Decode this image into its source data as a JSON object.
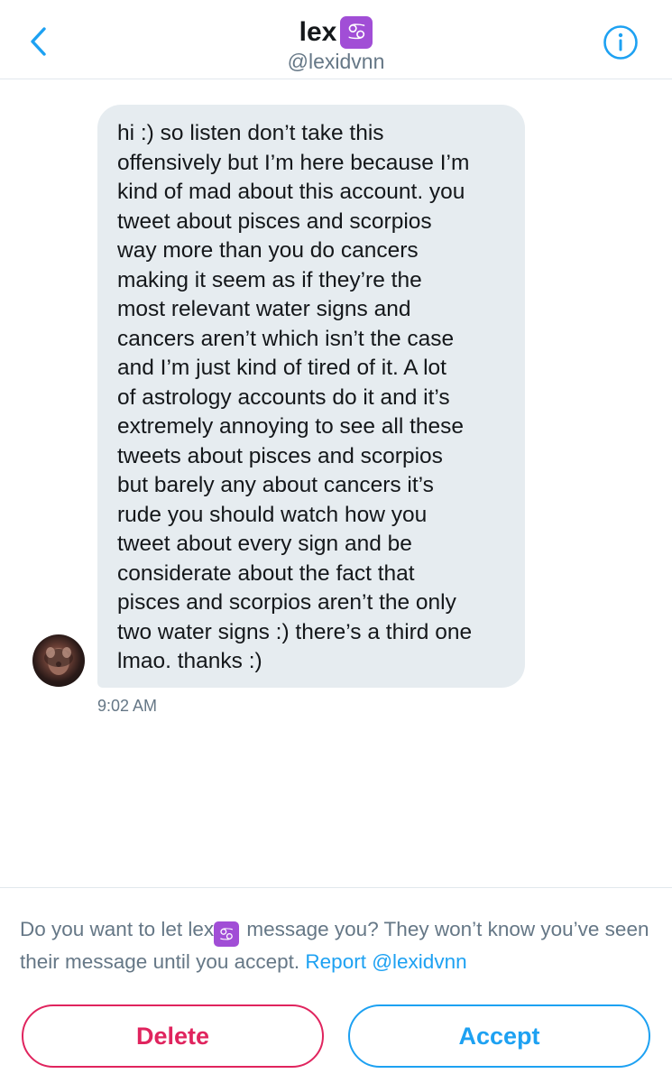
{
  "header": {
    "name": "lex",
    "sign_glyph": "♋",
    "handle": "@lexidvnn",
    "back_icon": "chevron-left-icon",
    "info_icon": "info-circle-icon"
  },
  "conversation": {
    "message": "hi :) so listen don’t take this offensively but I’m here because I’m kind of mad about this account. you tweet about pisces and scorpios way more than you do cancers making it seem as if they’re the most relevant water signs and cancers aren’t which isn’t the case and I’m just kind of tired of it. A lot of astrology accounts do it and it’s extremely annoying to see all these tweets about pisces and scorpios but barely any about cancers it’s rude you should watch how you tweet about every sign and be considerate about the fact that pisces and scorpios aren’t the only two water signs :) there’s a third one lmao. thanks :)",
    "message_lines": [
      "hi :) so listen don’t take this",
      "offensively but I’m here because I’m",
      "kind of mad about this account. you",
      "tweet about pisces and scorpios",
      "way more than you do cancers",
      "making it seem as if they’re the",
      "most relevant water signs and",
      "cancers aren’t which isn’t the case",
      "and I’m just kind of tired of it. A lot",
      "of astrology accounts do it and it’s",
      "extremely annoying to see all these",
      "tweets about pisces and scorpios",
      "but barely any about cancers it’s",
      "rude you should watch how you",
      "tweet about every sign and be",
      "considerate about the fact that",
      "pisces and scorpios aren’t the only",
      "two water signs :) there’s a third one",
      "lmao. thanks :)"
    ],
    "timestamp": "9:02 AM"
  },
  "request": {
    "prompt_prefix": "Do you want to let lex",
    "prompt_sign_glyph": "♋",
    "prompt_suffix": " message you? They won’t know you’ve seen their message until you accept. ",
    "report_link": "Report @lexidvnn",
    "delete_label": "Delete",
    "accept_label": "Accept"
  },
  "colors": {
    "accent_blue": "#1da1f2",
    "delete_red": "#e0245e",
    "bubble_gray": "#e6ecf0",
    "sign_purple": "#a14ed6",
    "secondary_text": "#657786"
  }
}
